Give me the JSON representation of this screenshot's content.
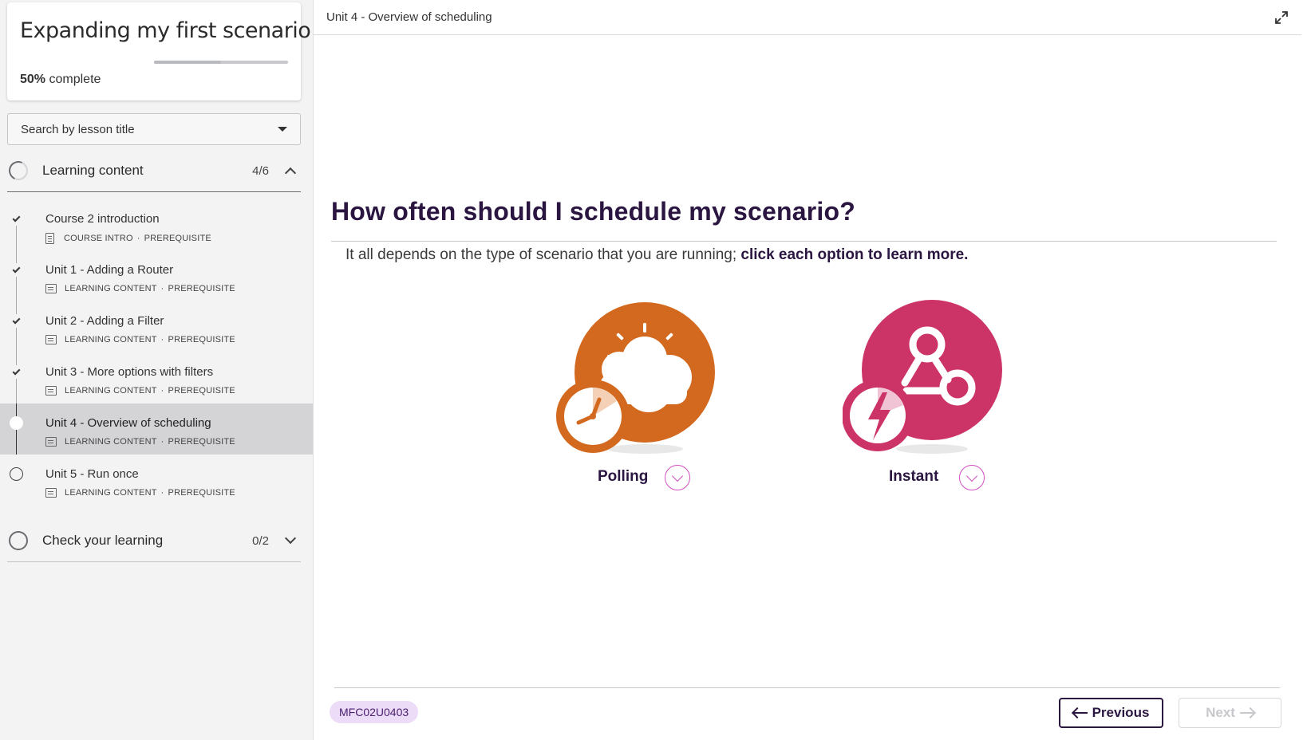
{
  "course": {
    "title": "Expanding my first scenario",
    "progress_percent": "50%",
    "progress_label": "complete",
    "progress_fraction": 0.5
  },
  "search": {
    "label": "Search by lesson title"
  },
  "sections": [
    {
      "label": "Learning content",
      "count": "4/6",
      "expanded": true,
      "lessons": [
        {
          "title": "Course 2 introduction",
          "type": "COURSE INTRO",
          "tag": "PREREQUISITE",
          "status": "complete"
        },
        {
          "title": "Unit 1 - Adding a Router",
          "type": "LEARNING CONTENT",
          "tag": "PREREQUISITE",
          "status": "complete"
        },
        {
          "title": "Unit 2 - Adding a Filter",
          "type": "LEARNING CONTENT",
          "tag": "PREREQUISITE",
          "status": "complete"
        },
        {
          "title": "Unit 3 - More options with filters",
          "type": "LEARNING CONTENT",
          "tag": "PREREQUISITE",
          "status": "complete"
        },
        {
          "title": "Unit 4 - Overview of scheduling",
          "type": "LEARNING CONTENT",
          "tag": "PREREQUISITE",
          "status": "current"
        },
        {
          "title": "Unit 5 - Run once",
          "type": "LEARNING CONTENT",
          "tag": "PREREQUISITE",
          "status": "not-started"
        }
      ]
    },
    {
      "label": "Check your learning",
      "count": "0/2",
      "expanded": false
    }
  ],
  "meta_separator": "·",
  "main": {
    "breadcrumb": "Unit 4 - Overview of scheduling",
    "heading": "How often should I schedule my scenario?",
    "intro_plain": "It all depends on the type of scenario that you are running; ",
    "intro_bold": "click each option to learn more.",
    "options": [
      {
        "label": "Polling",
        "icon": "cloud-clock-icon",
        "color": "#d2691e"
      },
      {
        "label": "Instant",
        "icon": "webhook-bolt-icon",
        "color": "#cc3366"
      }
    ],
    "lesson_code": "MFC02U0403",
    "previous_label": "Previous",
    "next_label": "Next"
  },
  "colors": {
    "accent_dark": "#2a1640",
    "accent_pink": "#d24fc2",
    "polling_orange": "#d2691e",
    "instant_pink": "#cc3366",
    "badge_bg": "#ecdcf8"
  }
}
